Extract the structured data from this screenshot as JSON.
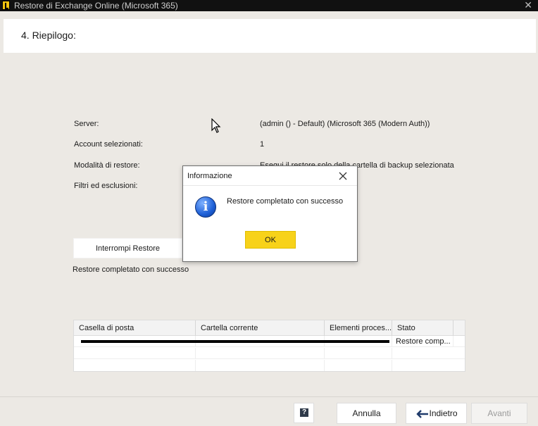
{
  "window": {
    "title": "Restore di Exchange Online (Microsoft 365)",
    "close_glyph": "✕"
  },
  "header": {
    "step_title": "4. Riepilogo:"
  },
  "summary": {
    "rows": [
      {
        "label": "Server:",
        "value": "(admin () - Default) (Microsoft 365 (Modern Auth))"
      },
      {
        "label": "Account selezionati:",
        "value": "1"
      },
      {
        "label": "Modalità di restore:",
        "value": "Esegui il restore solo della cartella di backup selezionata"
      },
      {
        "label": "Filtri ed esclusioni:",
        "value": ""
      }
    ]
  },
  "actions": {
    "stop_label": "Interrompi Restore",
    "status_text": "Restore completato con successo"
  },
  "grid": {
    "columns": [
      "Casella di posta",
      "Cartella corrente",
      "Elementi proces...",
      "Stato"
    ],
    "rows": [
      {
        "mailbox": "",
        "folder": "",
        "items": "",
        "status": "Restore comp..."
      }
    ]
  },
  "footer": {
    "help_label": "?",
    "cancel_label": "Annulla",
    "back_label": "Indietro",
    "next_label": "Avanti"
  },
  "dialog": {
    "title": "Informazione",
    "message": "Restore completato con successo",
    "ok_label": "OK",
    "icon": "info-icon"
  },
  "colors": {
    "ok_button": "#f7d21a",
    "app_icon": "#f1c40f",
    "titlebar": "#111111",
    "background": "#ece9e4"
  }
}
